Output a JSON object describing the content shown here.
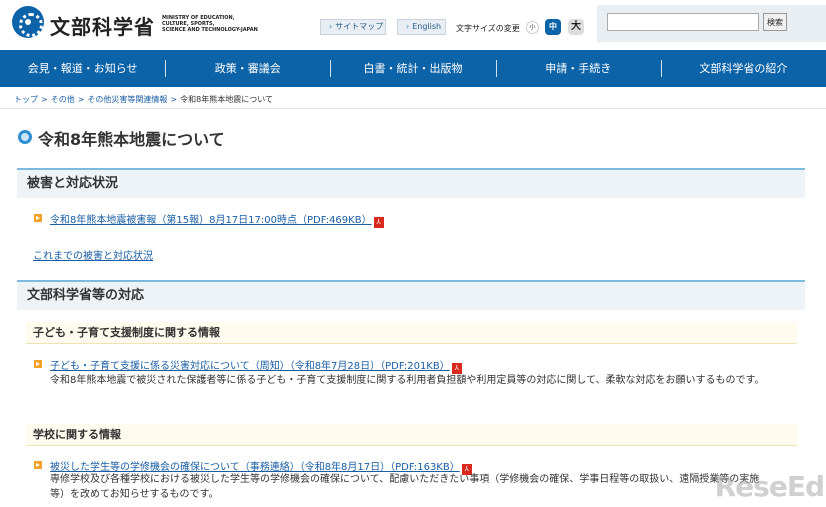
{
  "header": {
    "logo_ja": "文部科学省",
    "logo_en": [
      "MINISTRY OF EDUCATION,",
      "CULTURE, SPORTS,",
      "SCIENCE AND TECHNOLOGY-JAPAN"
    ],
    "sitemap_label": "サイトマップ",
    "english_label": "English",
    "font_size_label": "文字サイズの変更",
    "font_small": "小",
    "font_medium": "中",
    "font_large": "大",
    "search_placeholder": "",
    "search_button": "検索"
  },
  "nav": {
    "items": [
      "会見・報道・お知らせ",
      "政策・審議会",
      "白書・統計・出版物",
      "申請・手続き",
      "文部科学省の紹介"
    ]
  },
  "breadcrumb": {
    "items": [
      "トップ",
      "その他",
      "その他災害等関連情報"
    ],
    "current": "令和8年熊本地震について",
    "separator": ">"
  },
  "page": {
    "title": "令和8年熊本地震について"
  },
  "section1": {
    "heading": "被害と対応状況",
    "link1": "令和8年熊本地震被害報（第15報）8月17日17:00時点（PDF:469KB）",
    "link2": "これまでの被害と対応状況"
  },
  "section2": {
    "heading": "文部科学省等の対応",
    "sub1": {
      "heading": "子ども・子育て支援制度に関する情報",
      "link": "子ども・子育て支援に係る災害対応について（周知）（令和8年7月28日）（PDF:201KB）",
      "desc": "令和8年熊本地震で被災された保護者等に係る子ども・子育て支援制度に関する利用者負担額や利用定員等の対応に関して、柔軟な対応をお願いするものです。"
    },
    "sub2": {
      "heading": "学校に関する情報",
      "link": "被災した学生等の学修機会の確保について（事務連絡）（令和8年8月17日）（PDF:163KB）",
      "desc": "専修学校及び各種学校における被災した学生等の学修機会の確保について、配慮いただきたい事項（学修機会の確保、学事日程等の取扱い、遠隔授業等の実施 等）を改めてお知らせするものです。"
    }
  },
  "icons": {
    "pdf": "pdf-icon",
    "bullet": "arrow-bullet-icon"
  },
  "colors": {
    "brand_blue": "#0c63a8",
    "link": "#1a5ea4",
    "pdf_red": "#d9281d",
    "bullet_orange": "#f2a22b"
  },
  "watermark": "ReseEd"
}
